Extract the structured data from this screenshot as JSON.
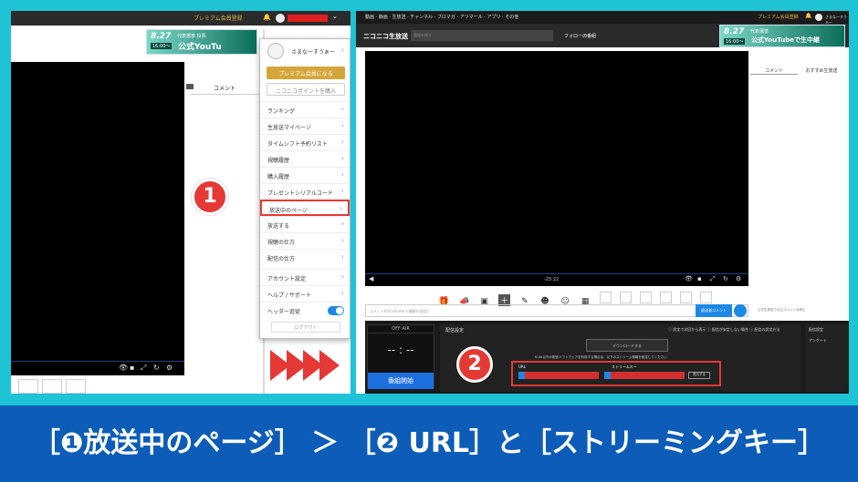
{
  "left": {
    "topbar": {
      "premium": "プレミアム会員登録"
    },
    "banner": {
      "date": "8.27",
      "sub": "代表選挙 投票",
      "time": "16:00〜",
      "main": "公式YouTu"
    },
    "tabs": {
      "comment": "コメント"
    },
    "menu": {
      "username": "さまな一すうぁー",
      "premium_button": "プレミアム会員になる",
      "points_button": "ニコニコポイントを購入",
      "items": [
        {
          "label": "ランキング"
        },
        {
          "label": "生放送マイページ"
        },
        {
          "label": "タイムシフト予約リスト"
        },
        {
          "label": "視聴履歴"
        },
        {
          "label": "購入履歴"
        },
        {
          "label": "プレゼントシリアルコード"
        },
        {
          "label": "放送中のページ"
        },
        {
          "label": "放送する"
        },
        {
          "label": "視聴の仕方"
        },
        {
          "label": "配信の仕方"
        },
        {
          "label": "アカウント設定"
        },
        {
          "label": "ヘルプ / サポート"
        },
        {
          "label": "ヘッダー追従"
        }
      ],
      "logout": "ログアウト"
    }
  },
  "right": {
    "topnav": "動画 · 静画 · 生放送 · チャンネル · ブロマガ · アツマール · アプリ · その他",
    "premium": "プレミアム会員登録",
    "logo": "ニコニコ生放送",
    "search_placeholder": "番組を探す",
    "follow": "フォローの番組",
    "banner": {
      "date": "8.27",
      "sub": "代表選挙",
      "time": "16:00〜",
      "main": "公式YouTubeで生中継"
    },
    "video_time": "-25:22",
    "tabs": {
      "comment": "コメント",
      "recommend": "おすすめ生放送"
    },
    "comment_placeholder": "コメント(Ctrl+Enterで複数行送信)",
    "comment_button": "放送者コメント",
    "right_note": "公式生放送では主コメントは禁止",
    "offair": {
      "label": "OFF AIR",
      "clock": "-- : --",
      "start": "番組開始"
    },
    "settings": {
      "title": "配信設定",
      "options": "ⓘ 設定で次回から表示  ⓘ 配信が安定しない場合  ⓘ 配信の設定方法",
      "download": "デウンロードする",
      "desc": "N Air以外の配信ソフトウェアを利用する場合は、以下のストリーム情報を設定してください",
      "url_label": "URL",
      "key_label": "ストリームキー",
      "show": "表示する"
    },
    "side": {
      "broadcast_settings": "配信設定",
      "survey": "アンケート"
    }
  },
  "badges": {
    "one": "1",
    "two": "2"
  },
  "caption": "［❶放送中のページ］ ＞ ［❷ URL］と［ストリーミングキー］",
  "colors": {
    "background": "#1ec3d6",
    "caption_bg": "#0d5db8",
    "highlight": "#e53935",
    "accent": "#1e88e5"
  }
}
